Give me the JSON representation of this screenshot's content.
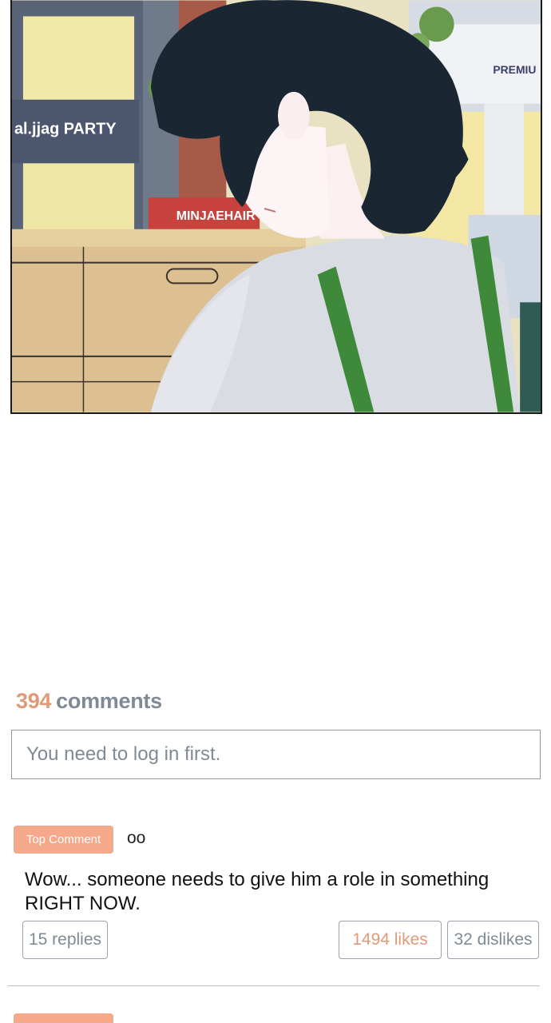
{
  "panel": {
    "signs": {
      "party": "al.jjag PARTY",
      "hair": "MINJAEHAIR",
      "premium": "PREMIU"
    }
  },
  "comments": {
    "count": "394",
    "word": "comments",
    "login_placeholder": "You need to log in first."
  },
  "top_comment": {
    "badge": "Top Comment",
    "author": "oo",
    "text": "Wow... someone needs to give him a role in something RIGHT NOW.",
    "replies": "15 replies",
    "likes": "1494 likes",
    "dislikes": "32 dislikes"
  },
  "colors": {
    "accent": "#e09a78",
    "badge": "#f5a88a",
    "muted": "#7f8a96"
  }
}
